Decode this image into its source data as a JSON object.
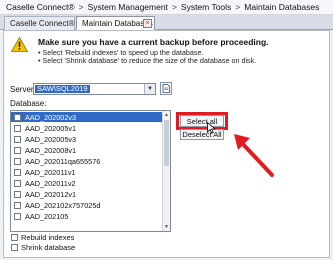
{
  "breadcrumb": {
    "items": [
      "Caselle Connect®",
      "System Management",
      "System Tools",
      "Maintain Databases"
    ],
    "separator": ">"
  },
  "tabs": [
    {
      "label": "Caselle Connect®"
    },
    {
      "label": "Maintain Databases",
      "close": "×"
    }
  ],
  "message": {
    "title": "Make sure you have a current backup before proceeding.",
    "lines": [
      "• Select 'Rebuild indexes' to speed up the database.",
      "• Select 'Shrink database' to reduce the size of the database on disk."
    ]
  },
  "server": {
    "label": "Server:",
    "value": "SAW\\SQL2019"
  },
  "database": {
    "label": "Database:",
    "items": [
      {
        "name": "AAD_202002v3",
        "selected": true
      },
      {
        "name": "AAD_202005v1",
        "selected": false
      },
      {
        "name": "AAD_202005v3",
        "selected": false
      },
      {
        "name": "AAD_202008v1",
        "selected": false
      },
      {
        "name": "AAD_202011qa655576",
        "selected": false
      },
      {
        "name": "AAD_202011v1",
        "selected": false
      },
      {
        "name": "AAD_202011v2",
        "selected": false
      },
      {
        "name": "AAD_202012v1",
        "selected": false
      },
      {
        "name": "AAD_202102x757025d",
        "selected": false
      },
      {
        "name": "AAD_202105",
        "selected": false
      }
    ]
  },
  "buttons": {
    "select_all": "Select all",
    "deselect_all": "Deselect All"
  },
  "options": {
    "rebuild_indexes": "Rebuild indexes",
    "shrink_database": "Shrink database"
  },
  "colors": {
    "highlight": "#e01b22",
    "selection": "#3169c6"
  }
}
